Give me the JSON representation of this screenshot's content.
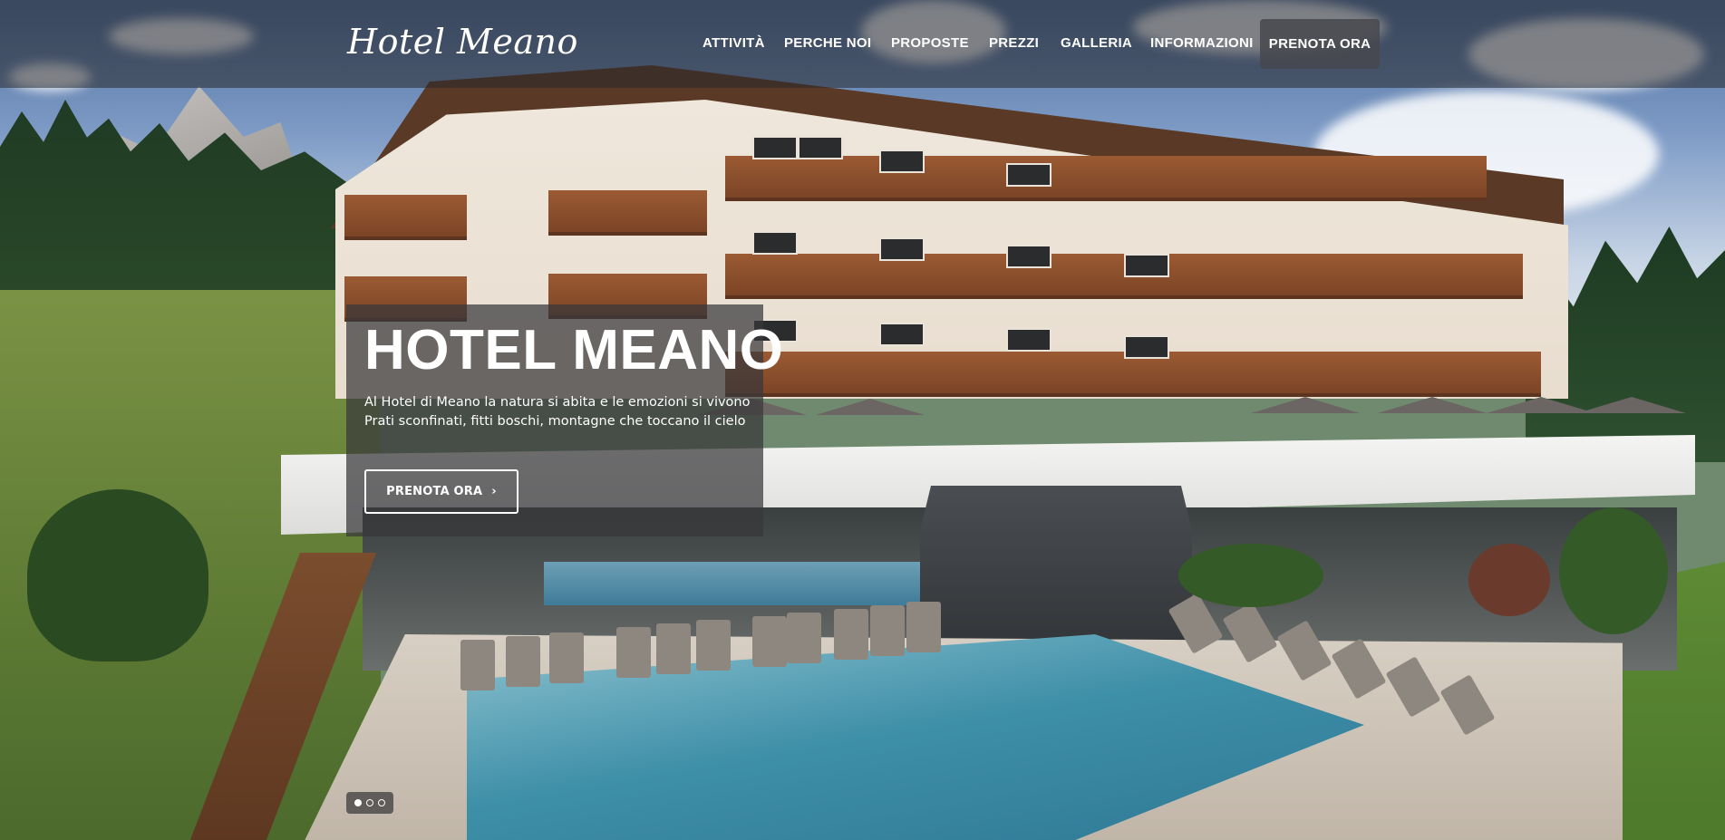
{
  "header": {
    "logo": "Hotel Meano",
    "nav": [
      {
        "label": "ATTIVITÀ"
      },
      {
        "label": "PERCHE NOI"
      },
      {
        "label": "PROPOSTE"
      },
      {
        "label": "PREZZI"
      },
      {
        "label": "GALLERIA"
      },
      {
        "label": "INFORMAZIONI"
      },
      {
        "label": "PRENOTA ORA"
      }
    ]
  },
  "hero": {
    "title": "HOTEL MEANO",
    "lines": [
      "Al Hotel di Meano la natura si abita e le emozioni si vivono",
      "Prati sconfinati, fitti boschi, montagne che toccano il cielo"
    ],
    "cta_label": "PRENOTA ORA",
    "cta_icon": "chevron-right-icon"
  },
  "slider": {
    "slides": 3,
    "active": 1
  },
  "colors": {
    "header_bg": "rgba(40,40,44,0.55)",
    "caption_bg": "rgba(55,55,58,0.72)",
    "text": "#ffffff"
  }
}
